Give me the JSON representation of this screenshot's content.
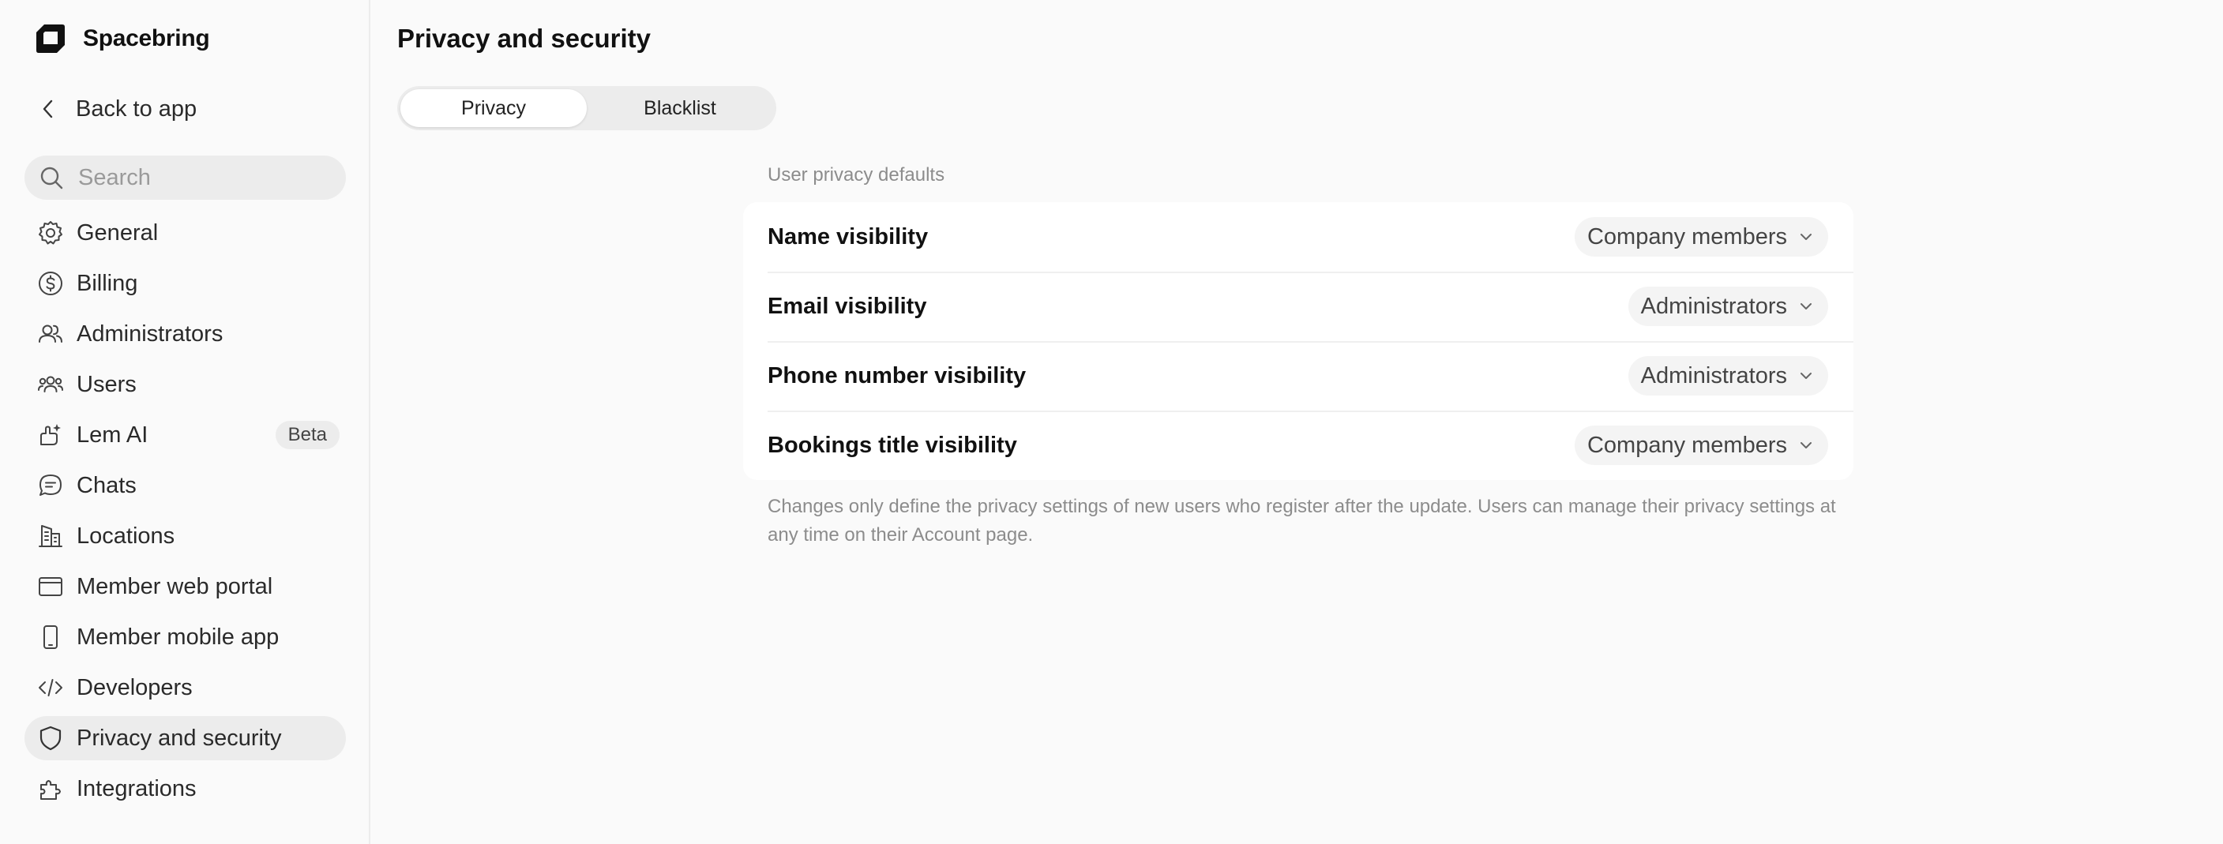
{
  "brand": {
    "name": "Spacebring",
    "logo_icon": "spacebring-logo-icon"
  },
  "sidebar": {
    "back_label": "Back to app",
    "search_placeholder": "Search",
    "items": [
      {
        "label": "General",
        "icon": "gear-icon"
      },
      {
        "label": "Billing",
        "icon": "dollar-circle-icon"
      },
      {
        "label": "Administrators",
        "icon": "users-icon"
      },
      {
        "label": "Users",
        "icon": "user-group-icon"
      },
      {
        "label": "Lem AI",
        "icon": "ai-hand-icon",
        "badge": "Beta"
      },
      {
        "label": "Chats",
        "icon": "chat-bubble-icon"
      },
      {
        "label": "Locations",
        "icon": "building-icon"
      },
      {
        "label": "Member web portal",
        "icon": "browser-window-icon"
      },
      {
        "label": "Member mobile app",
        "icon": "mobile-phone-icon"
      },
      {
        "label": "Developers",
        "icon": "code-icon"
      },
      {
        "label": "Privacy and security",
        "icon": "shield-icon",
        "active": true
      },
      {
        "label": "Integrations",
        "icon": "puzzle-icon"
      }
    ]
  },
  "main": {
    "title": "Privacy and security",
    "tabs": [
      {
        "label": "Privacy",
        "active": true
      },
      {
        "label": "Blacklist",
        "active": false
      }
    ],
    "section_label": "User privacy defaults",
    "settings": [
      {
        "label": "Name visibility",
        "value": "Company members"
      },
      {
        "label": "Email visibility",
        "value": "Administrators"
      },
      {
        "label": "Phone number visibility",
        "value": "Administrators"
      },
      {
        "label": "Bookings title visibility",
        "value": "Company members"
      }
    ],
    "footnote": "Changes only define the privacy settings of new users who register after the update. Users can manage their privacy settings at any time on their Account page."
  },
  "colors": {
    "background": "#fafafa",
    "card": "#ffffff",
    "pill": "#ececec",
    "text": "#1a1a1a",
    "muted": "#8c8c8c"
  }
}
